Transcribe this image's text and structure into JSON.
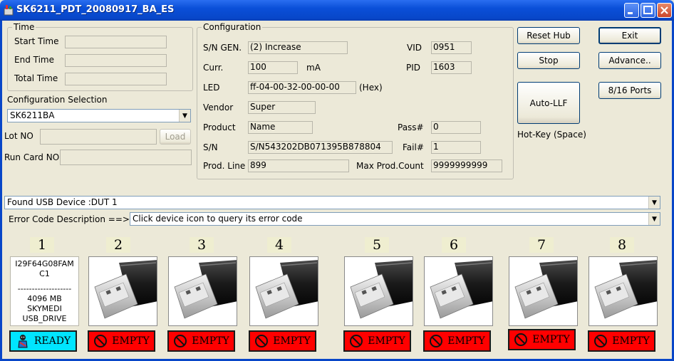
{
  "window": {
    "title": "SK6211_PDT_20080917_BA_ES"
  },
  "time": {
    "legend": "Time",
    "start_label": "Start Time",
    "end_label": "End Time",
    "total_label": "Total Time",
    "start_value": "",
    "end_value": "",
    "total_value": ""
  },
  "config_selection": {
    "label": "Configuration Selection",
    "value": "SK6211BA"
  },
  "lot": {
    "label": "Lot NO",
    "value": "",
    "load_button": "Load"
  },
  "run_card": {
    "label": "Run Card NO:",
    "value": ""
  },
  "configuration": {
    "legend": "Configuration",
    "sn_gen_label": "S/N GEN.",
    "sn_gen_value": "(2) Increase",
    "vid_label": "VID",
    "vid_value": "0951",
    "curr_label": "Curr.",
    "curr_value": "100",
    "curr_unit": "mA",
    "pid_label": "PID",
    "pid_value": "1603",
    "led_label": "LED",
    "led_value": "ff-04-00-32-00-00-00",
    "led_unit": "(Hex)",
    "vendor_label": "Vendor",
    "vendor_value": "Super",
    "product_label": "Product",
    "product_value": "Name",
    "pass_label": "Pass#",
    "pass_value": "0",
    "sn_label": "S/N",
    "sn_value": "S/N543202DB071395B878804",
    "fail_label": "Fail#",
    "fail_value": "1",
    "prod_line_label": "Prod. Line",
    "prod_line_value": "899",
    "max_prod_label": "Max Prod.Count",
    "max_prod_value": "9999999999"
  },
  "buttons": {
    "reset_hub": "Reset Hub",
    "exit": "Exit",
    "stop": "Stop",
    "advance": "Advance..",
    "auto_llf": "Auto-LLF",
    "ports": "8/16 Ports",
    "hotkey": "Hot-Key (Space)"
  },
  "found_device": "Found USB Device :DUT 1",
  "error_code": {
    "label": "Error Code Description ==>",
    "value": "Click device icon to query its error code"
  },
  "slots": [
    {
      "num": "1",
      "status": "READY"
    },
    {
      "num": "2",
      "status": "EMPTY"
    },
    {
      "num": "3",
      "status": "EMPTY"
    },
    {
      "num": "4",
      "status": "EMPTY"
    },
    {
      "num": "5",
      "status": "EMPTY"
    },
    {
      "num": "6",
      "status": "EMPTY"
    },
    {
      "num": "7",
      "status": "EMPTY"
    },
    {
      "num": "8",
      "status": "EMPTY"
    }
  ],
  "slot1_info": {
    "line1": "I29F64G08FAM",
    "line2": "C1",
    "divider": "-------------------",
    "line3": "4096 MB",
    "line4": "SKYMEDI",
    "line5": "USB_DRIVE"
  },
  "colors": {
    "titlebar": "#0a4fd8",
    "empty": "#ff0000",
    "ready": "#00e5ff",
    "background": "#ece9d8"
  },
  "icons": {
    "empty": "prohibited-icon",
    "ready": "ready-person-icon",
    "usb": "usb-drive-icon"
  }
}
